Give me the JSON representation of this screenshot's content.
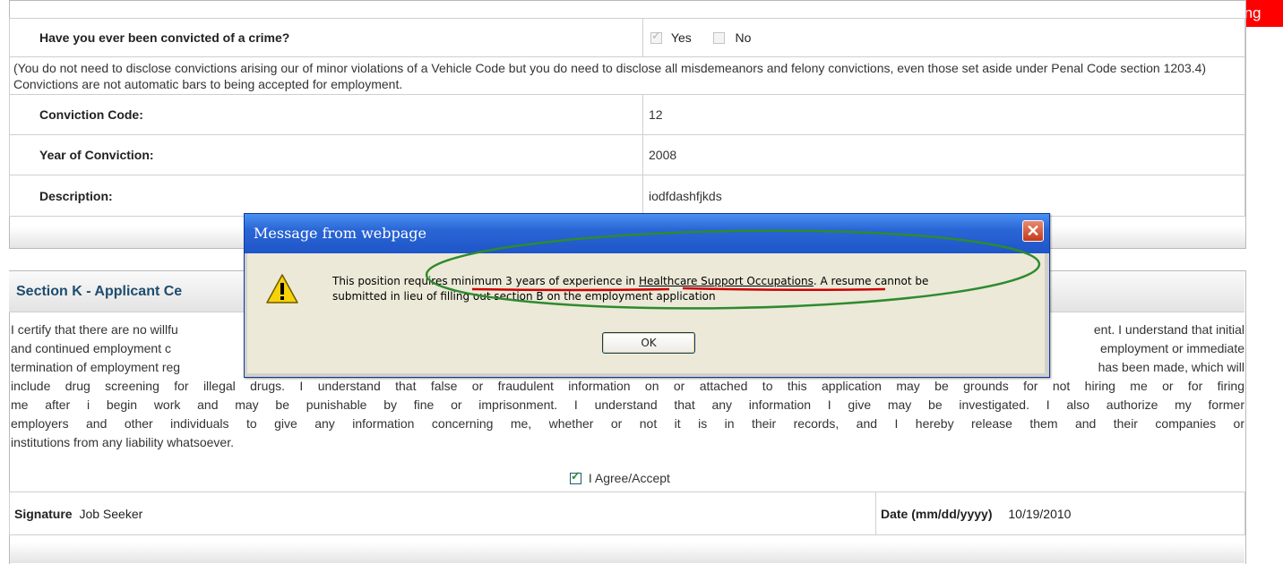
{
  "loading_label": "Loading",
  "crime_section": {
    "question": "Have you ever been convicted of a crime?",
    "yes_label": "Yes",
    "no_label": "No",
    "yes_checked": true,
    "no_checked": false,
    "note": "(You do not need to disclose convictions arising our of minor violations of a Vehicle Code but you do need to disclose all misdemeanors and felony convictions, even those set aside under Penal Code section 1203.4) Convictions are not automatic bars to being accepted for employment.",
    "fields": [
      {
        "label": "Conviction Code:",
        "value": "12"
      },
      {
        "label": "Year of Conviction:",
        "value": "2008"
      },
      {
        "label": "Description:",
        "value": "iodfdashfjkds"
      }
    ]
  },
  "section_k": {
    "title": "Section K - Applicant Ce",
    "certification_lines": [
      "I certify that there are no willfu",
      "and continued employment c",
      "termination of employment reg",
      "include drug screening for illegal drugs. I understand that false or fraudulent information on or attached to this application may be grounds for not hiring me or for firing",
      "me after i begin work and may be punishable by fine or imprisonment. I understand that any information I give may be investigated. I also authorize my former",
      "employers and other individuals to give any information concerning me, whether or not it is in their records, and I hereby release them and their companies or",
      "institutions from any liability whatsoever."
    ],
    "right_fragments": [
      "ent. I understand that initial",
      "employment or immediate",
      "has been made, which will"
    ],
    "agree_label": "I Agree/Accept",
    "agree_checked": true,
    "signature_label": "Signature",
    "signature_value": "Job Seeker",
    "date_label": "Date (mm/dd/yyyy)",
    "date_value": "10/19/2010"
  },
  "dialog": {
    "title": "Message from webpage",
    "message_parts": {
      "p1": "This position requires ",
      "p2": "minimum 3 years of experience",
      "p3": " in ",
      "p4": "Healthcare Support Occupations",
      "p5": ". A resume cannot be",
      "line2": "submitted in lieu of filling out section B on the employment application"
    },
    "ok_label": "OK",
    "close_glyph": "✕",
    "icon": "warning-icon"
  },
  "colors": {
    "dialog_title_bar": "#2a66d6",
    "loading_bg": "#ff0000",
    "section_title": "#1d4c6e",
    "annotation_ellipse": "#2e8b2e",
    "annotation_underline": "#cc0000"
  }
}
